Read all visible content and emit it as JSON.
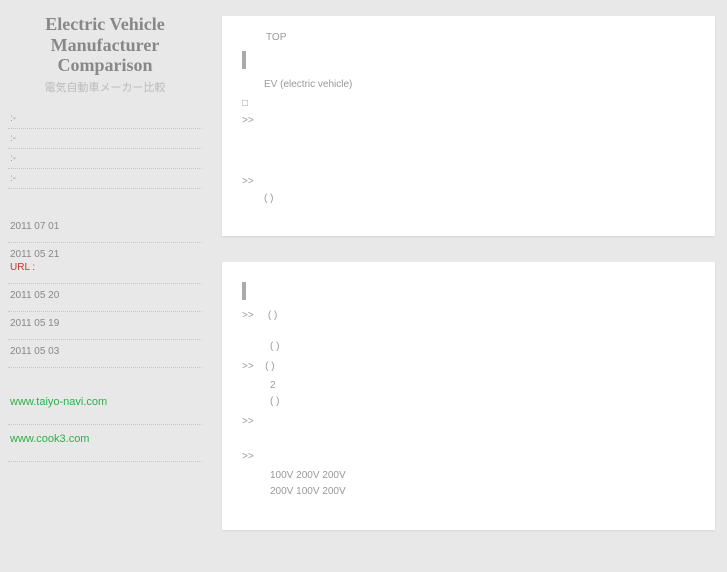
{
  "site": {
    "title_line1": "Electric Vehicle",
    "title_line2": "Manufacturer",
    "title_line3": "Comparison",
    "subtitle": "電気自動車メーカー比較"
  },
  "nav": {
    "items": [
      {
        "label": ":-"
      },
      {
        "label": ":-"
      },
      {
        "label": ":-"
      },
      {
        "label": ":-"
      }
    ]
  },
  "news": {
    "items": [
      {
        "date": "2011 07 01",
        "body": ""
      },
      {
        "date": "2011 05 21",
        "body": "URL :",
        "body_class": "url-label"
      },
      {
        "date": "2011 05 20",
        "body": ""
      },
      {
        "date": "2011 05 19",
        "body": ""
      },
      {
        "date": "2011 05 03",
        "body": ""
      }
    ]
  },
  "ext_links": {
    "items": [
      {
        "label": "www.taiyo-navi.com"
      },
      {
        "label": "www.cook3.com"
      }
    ]
  },
  "card1": {
    "crumb": "TOP",
    "heading": " ",
    "intro": "EV (electric vehicle)",
    "lines": [
      {
        "sym": "□",
        "text": ""
      },
      {
        "sym": ">>",
        "text": ""
      }
    ],
    "lines2": [
      {
        "sym": ">>",
        "text": ""
      }
    ],
    "footer_paren": "(                     )"
  },
  "card2": {
    "heading": " ",
    "rows": [
      {
        "sym": ">>",
        "head": "(    )"
      },
      {
        "sym": "",
        "head": "",
        "sub": "(                       )"
      },
      {
        "sym": ">>",
        "head": "(    )",
        "sub1": "2",
        "sub2": "(     )"
      },
      {
        "sym": ">>",
        "head": ""
      },
      {
        "sym": ">>",
        "head": ""
      }
    ],
    "tail1": "100V 200V       200V",
    "tail2": "200V        100V 200V"
  }
}
